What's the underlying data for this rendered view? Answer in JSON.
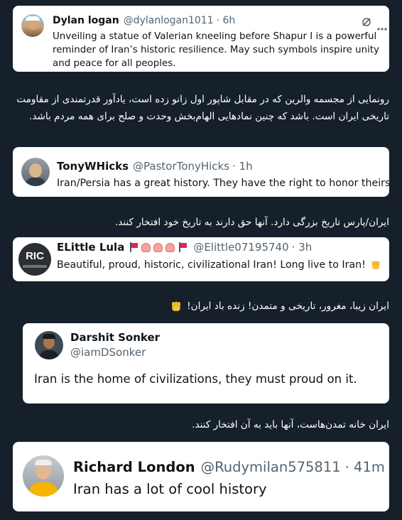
{
  "tweets": [
    {
      "name": "Dylan logan",
      "handle": "@dylanlogan1011",
      "time": "· 6h",
      "text": "Unveiling a statue of Valerian kneeling before Shapur I is a powerful reminder of Iran’s historic resilience. May such symbols inspire unity and peace for all peoples."
    },
    {
      "name": "TonyWHicks",
      "handle": "@PastorTonyHicks",
      "time": "· 1h",
      "text": "Iran/Persia has a great history. They have the right to honor theirs"
    },
    {
      "name": "ELittle Lula",
      "handle": "@Elittle07195740",
      "time": "· 3h",
      "avatar_text": "RIC",
      "text": "Beautiful, proud, historic, civilizational Iran! Long live to Iran!"
    },
    {
      "name": "Darshit Sonker",
      "handle": "@iamDSonker",
      "text": "Iran is the home of civilizations, they must proud on it."
    },
    {
      "name": "Richard London",
      "handle": "@Rudymilan575811",
      "time": "· 41m",
      "text": "Iran has a lot of cool history"
    }
  ],
  "translations": [
    "رونمایی از مجسمه والرین که در مقابل شاپور اول زانو زده است، یادآور قدرتمندی از مقاومت تاریخی ایران است. باشد که چنین نمادهایی الهام‌بخش وحدت و صلح برای همه مردم باشد.",
    "ایران/پارس تاریخ بزرگی دارد. آنها حق دارند به تاریخ خود افتخار کنند.",
    "ایران زیبا، مغرور، تاریخی و متمدن! زنده باد ایران!",
    "ایران خانه تمدن‌هاست، آنها باید به آن افتخار کنند."
  ],
  "colors": {
    "background": "#15202b",
    "card": "#ffffff",
    "muted": "#536471"
  },
  "icons": [
    "grok-icon",
    "more-icon",
    "red-flag-icon",
    "octopus-icon",
    "raised-fist-icon"
  ]
}
